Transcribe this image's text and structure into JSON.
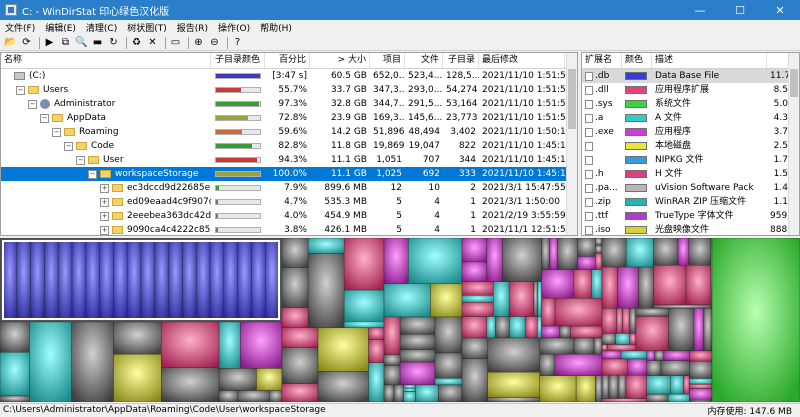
{
  "window": {
    "title": "C: - WinDirStat 印心绿色汉化版",
    "minimize": "—",
    "maximize": "☐",
    "close": "✕"
  },
  "menu": [
    "文件(F)",
    "编辑(E)",
    "清理(C)",
    "树状图(T)",
    "报告(R)",
    "操作(O)",
    "帮助(H)"
  ],
  "toolbar": [
    {
      "icon": "open-icon",
      "glyph": "📂"
    },
    {
      "icon": "refresh-icon",
      "glyph": "⟳"
    },
    {
      "sep": true
    },
    {
      "icon": "play-icon",
      "glyph": "▶"
    },
    {
      "icon": "copy-icon",
      "glyph": "⧉"
    },
    {
      "icon": "explorer-icon",
      "glyph": "🔍"
    },
    {
      "icon": "cmd-icon",
      "glyph": "▬"
    },
    {
      "icon": "reload-icon",
      "glyph": "↻"
    },
    {
      "sep": true
    },
    {
      "icon": "recycle-icon",
      "glyph": "♻"
    },
    {
      "icon": "delete-icon",
      "glyph": "✕"
    },
    {
      "sep": true
    },
    {
      "icon": "new-folder-icon",
      "glyph": "▭"
    },
    {
      "sep": true
    },
    {
      "icon": "zoom-in-icon",
      "glyph": "⊕"
    },
    {
      "icon": "zoom-out-icon",
      "glyph": "⊖"
    },
    {
      "sep": true
    },
    {
      "icon": "help-icon",
      "glyph": "?"
    }
  ],
  "tree": {
    "headers": [
      "名称",
      "子目录颜色",
      "百分比",
      "> 大小",
      "项目",
      "文件",
      "子目录",
      "最后修改"
    ],
    "rows": [
      {
        "depth": 0,
        "expand": "",
        "icon": "drive",
        "name": "(C:)",
        "bar": 0,
        "pctLabel": "[3:47 s]",
        "size": "60.5 GB",
        "items": "652,0...",
        "files": "523,4...",
        "subdirs": "128,5...",
        "modified": "2021/11/10  1:51:56",
        "barColor": "#3b3bb5"
      },
      {
        "depth": 1,
        "expand": "−",
        "icon": "folder",
        "name": "Users",
        "bar": 0.557,
        "pctLabel": "55.7%",
        "size": "33.7 GB",
        "items": "347,3...",
        "files": "293,0...",
        "subdirs": "54,274",
        "modified": "2021/11/10  1:51:56",
        "barColor": "#c83a3a"
      },
      {
        "depth": 2,
        "expand": "−",
        "icon": "user",
        "name": "Administrator",
        "bar": 0.973,
        "pctLabel": "97.3%",
        "size": "32.8 GB",
        "items": "344,7...",
        "files": "291,5...",
        "subdirs": "53,164",
        "modified": "2021/11/10  1:51:56",
        "barColor": "#3a9a3a"
      },
      {
        "depth": 3,
        "expand": "−",
        "icon": "folder",
        "name": "AppData",
        "bar": 0.728,
        "pctLabel": "72.8%",
        "size": "23.9 GB",
        "items": "169,3...",
        "files": "145,6...",
        "subdirs": "23,773",
        "modified": "2021/11/10  1:51:56",
        "barColor": "#a0a040"
      },
      {
        "depth": 4,
        "expand": "−",
        "icon": "folder",
        "name": "Roaming",
        "bar": 0.596,
        "pctLabel": "59.6%",
        "size": "14.2 GB",
        "items": "51,896",
        "files": "48,494",
        "subdirs": "3,402",
        "modified": "2021/11/10  1:50:17",
        "barColor": "#c86a3a"
      },
      {
        "depth": 5,
        "expand": "−",
        "icon": "folder",
        "name": "Code",
        "bar": 0.828,
        "pctLabel": "82.8%",
        "size": "11.8 GB",
        "items": "19,869",
        "files": "19,047",
        "subdirs": "822",
        "modified": "2021/11/10  1:45:18",
        "barColor": "#3a9a3a"
      },
      {
        "depth": 6,
        "expand": "−",
        "icon": "folder",
        "name": "User",
        "bar": 0.943,
        "pctLabel": "94.3%",
        "size": "11.1 GB",
        "items": "1,051",
        "files": "707",
        "subdirs": "344",
        "modified": "2021/11/10  1:45:18",
        "barColor": "#c83a3a"
      },
      {
        "depth": 7,
        "expand": "−",
        "icon": "folder",
        "name": "workspaceStorage",
        "bar": 1.0,
        "pctLabel": "100.0%",
        "size": "11.1 GB",
        "items": "1,025",
        "files": "692",
        "subdirs": "333",
        "modified": "2021/11/10  1:45:18",
        "barColor": "#a0a040",
        "selected": true
      },
      {
        "depth": 8,
        "expand": "+",
        "icon": "folder",
        "name": "ec3dccd9d22685eb0...",
        "bar": 0.079,
        "pctLabel": "7.9%",
        "size": "899.6 MB",
        "items": "12",
        "files": "10",
        "subdirs": "2",
        "modified": "2021/3/1   15:47:55",
        "barColor": "#3a9a3a"
      },
      {
        "depth": 8,
        "expand": "+",
        "icon": "folder",
        "name": "ed09eaad4c9f907cd3...",
        "bar": 0.047,
        "pctLabel": "4.7%",
        "size": "535.3 MB",
        "items": "5",
        "files": "4",
        "subdirs": "1",
        "modified": "2021/3/1   1:50:00",
        "barColor": "#3a9a3a"
      },
      {
        "depth": 8,
        "expand": "+",
        "icon": "folder",
        "name": "2eeebea363dc42d92...",
        "bar": 0.04,
        "pctLabel": "4.0%",
        "size": "454.9 MB",
        "items": "5",
        "files": "4",
        "subdirs": "1",
        "modified": "2021/2/19  3:55:59",
        "barColor": "#3a9a3a"
      },
      {
        "depth": 8,
        "expand": "+",
        "icon": "folder",
        "name": "9090ca4c4222c855e...",
        "bar": 0.038,
        "pctLabel": "3.8%",
        "size": "426.1 MB",
        "items": "5",
        "files": "4",
        "subdirs": "1",
        "modified": "2021/11/1  12:51:51",
        "barColor": "#3a9a3a"
      }
    ]
  },
  "extensions": {
    "headers": [
      "扩展名",
      "颜色",
      "描述",
      ""
    ],
    "rows": [
      {
        "ext": ".db",
        "color": "#3b3bd6",
        "desc": "Data Base File",
        "size": "11.7",
        "selected": true
      },
      {
        "ext": ".dll",
        "color": "#e8407a",
        "desc": "应用程序扩展",
        "size": "8.5"
      },
      {
        "ext": ".sys",
        "color": "#3ad43a",
        "desc": "系统文件",
        "size": "5.0"
      },
      {
        "ext": ".a",
        "color": "#34c8c8",
        "desc": "A 文件",
        "size": "4.3"
      },
      {
        "ext": ".exe",
        "color": "#d43ad4",
        "desc": "应用程序",
        "size": "3.7"
      },
      {
        "ext": "",
        "color": "#e6e63a",
        "desc": "本地磁盘",
        "size": "2.5"
      },
      {
        "ext": "",
        "color": "#3a9ad8",
        "desc": "NIPKG 文件",
        "size": "1.7"
      },
      {
        "ext": ".h",
        "color": "#d84080",
        "desc": "H 文件",
        "size": "1.5"
      },
      {
        "ext": ".pa...",
        "color": "#b8b8b8",
        "desc": "uVision Software Pack",
        "size": "1.4"
      },
      {
        "ext": ".zip",
        "color": "#28b4b4",
        "desc": "WinRAR ZIP 压缩文件",
        "size": "1.1"
      },
      {
        "ext": ".ttf",
        "color": "#b43ad4",
        "desc": "TrueType 字体文件",
        "size": "959."
      },
      {
        "ext": ".iso",
        "color": "#d4d43a",
        "desc": "光盘映像文件",
        "size": "888."
      }
    ]
  },
  "status": {
    "path": "C:\\Users\\Administrator\\AppData\\Roaming\\Code\\User\\workspaceStorage",
    "memLabel": "内存使用:",
    "memValue": "147.6 MB"
  }
}
